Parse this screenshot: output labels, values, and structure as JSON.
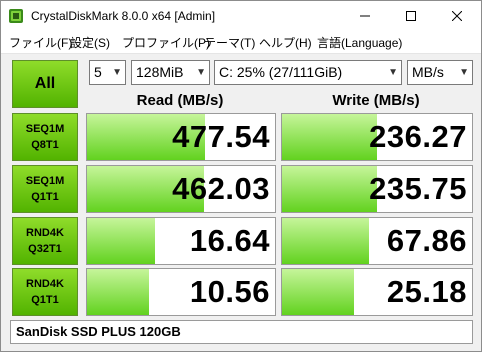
{
  "window": {
    "title": "CrystalDiskMark 8.0.0 x64 [Admin]"
  },
  "menu": [
    "ファイル(F)",
    "設定(S)",
    "プロファイル(P)",
    "テーマ(T)",
    "ヘルプ(H)",
    "言語(Language)"
  ],
  "controls": {
    "all_label": "All",
    "count": "5",
    "size": "128MiB",
    "drive": "C: 25% (27/111GiB)",
    "unit": "MB/s"
  },
  "headers": {
    "read": "Read (MB/s)",
    "write": "Write (MB/s)"
  },
  "tests": [
    {
      "line1": "SEQ1M",
      "line2": "Q8T1",
      "read": "477.54",
      "write": "236.27",
      "read_fill": 0.63,
      "write_fill": 0.5
    },
    {
      "line1": "SEQ1M",
      "line2": "Q1T1",
      "read": "462.03",
      "write": "235.75",
      "read_fill": 0.62,
      "write_fill": 0.5
    },
    {
      "line1": "RND4K",
      "line2": "Q32T1",
      "read": "16.64",
      "write": "67.86",
      "read_fill": 0.36,
      "write_fill": 0.46
    },
    {
      "line1": "RND4K",
      "line2": "Q1T1",
      "read": "10.56",
      "write": "25.18",
      "read_fill": 0.33,
      "write_fill": 0.38
    }
  ],
  "comment": "SanDisk SSD PLUS 120GB",
  "colors": {
    "button_green": "#52b300",
    "bar_green": "#62d21f"
  }
}
